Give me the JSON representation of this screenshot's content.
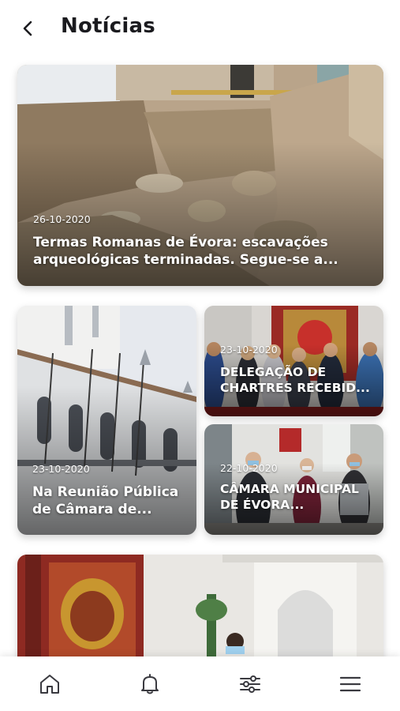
{
  "header": {
    "back_icon": "chevron-left-icon",
    "title": "Notícias"
  },
  "news": [
    {
      "date": "26-10-2020",
      "title": "Termas Romanas de Évora: escavações arqueológicas terminadas. Segue-se a..."
    },
    {
      "date": "23-10-2020",
      "title": "Na Reunião Pública de Câmara de..."
    },
    {
      "date": "23-10-2020",
      "title": "DELEGAÇÃO DE CHARTRES RECEBID..."
    },
    {
      "date": "22-10-2020",
      "title": "CÂMARA MUNICIPAL DE ÉVORA..."
    }
  ],
  "tabbar": {
    "items": [
      "home-icon",
      "bell-icon",
      "sliders-icon",
      "menu-icon"
    ]
  },
  "colors": {
    "title": "#1b1b1f",
    "icon": "#3a3a40"
  }
}
